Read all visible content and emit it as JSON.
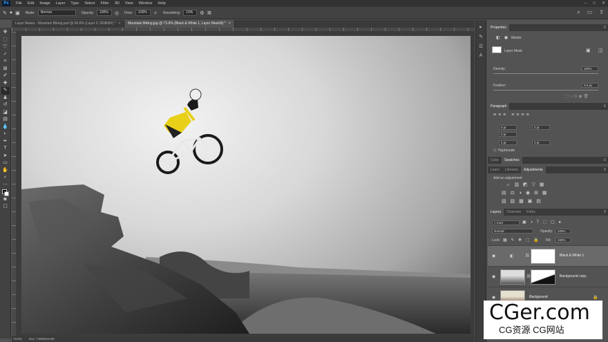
{
  "app": {
    "logo": "Ps"
  },
  "menu": [
    "File",
    "Edit",
    "Image",
    "Layer",
    "Type",
    "Select",
    "Filter",
    "3D",
    "View",
    "Window",
    "Help"
  ],
  "window_controls": [
    "–",
    "□",
    "✕"
  ],
  "options": {
    "mode_label": "Mode:",
    "mode_value": "Normal",
    "opacity_label": "Opacity:",
    "opacity_value": "100%",
    "flow_label": "Flow:",
    "flow_value": "100%",
    "smoothing_label": "Smoothing:",
    "smoothing_value": "10%"
  },
  "tabs": [
    {
      "label": "Layer Masks - Mountain Biking.psd @ 66.6% (Layer 0, RGB/8#) *",
      "close": "×"
    },
    {
      "label": "Mountain Biking.jpg @ 73.6% (Black & White 1, Layer Mask/8) *",
      "close": "×"
    }
  ],
  "status": {
    "zoom": "73.6%",
    "doc": "Doc: 7.80M/16.0M"
  },
  "properties": {
    "tab": "Properties",
    "masks_label": "Masks",
    "layer_mask_label": "Layer Mask",
    "density_label": "Density:",
    "density_value": "100%",
    "feather_label": "Feather:",
    "feather_value": "0.0 px"
  },
  "paragraph": {
    "tab": "Paragraph",
    "fields": [
      "0 pt",
      "0 pt",
      "0 pt",
      "0 pt",
      "0 pt"
    ],
    "hyphenate": "Hyphenate"
  },
  "color_tabs": [
    "Color",
    "Swatches"
  ],
  "adjust_tabs": [
    "Learn",
    "Libraries",
    "Adjustments"
  ],
  "adjust_hint": "Add an adjustment",
  "layers_panel": {
    "tabs": [
      "Layers",
      "Channels",
      "Paths"
    ],
    "kind": "Kind",
    "blend": "Normal",
    "opacity_label": "Opacity:",
    "opacity_value": "100%",
    "lock_label": "Lock:",
    "fill_label": "Fill:",
    "fill_value": "100%",
    "layers": [
      {
        "name": "Black & White 1"
      },
      {
        "name": "Background copy"
      },
      {
        "name": "Background"
      }
    ]
  },
  "watermark": {
    "main": "CGer.com",
    "sub": "CG资源 CG网站"
  },
  "colors": {
    "ui_dark": "#323232",
    "panel": "#535353",
    "accent": "#31a8ff",
    "mask_fill": "#ffffff",
    "rider_yellow": "#e8d018"
  }
}
